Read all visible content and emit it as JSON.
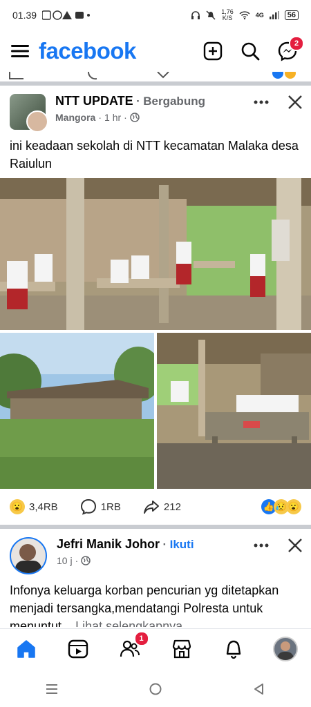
{
  "status_bar": {
    "time": "01.39",
    "speed_value": "1,76",
    "speed_unit": "K/S",
    "network": "4G",
    "battery": "56"
  },
  "header": {
    "logo": "facebook",
    "messenger_badge": "2"
  },
  "post1": {
    "group_name": "NTT UPDATE",
    "separator": "·",
    "join_label": "Bergabung",
    "author": "Mangora",
    "time": "1 hr",
    "text": "ini keadaan sekolah di NTT kecamatan Malaka desa Raiulun",
    "reaction_count": "3,4RB",
    "comment_count": "1RB",
    "share_count": "212"
  },
  "post2": {
    "author": "Jefri Manik Johor",
    "separator": "·",
    "follow_label": "Ikuti",
    "time": "10 j",
    "text": "Infonya keluarga korban pencurian yg ditetapkan menjadi tersangka,mendatangi Polresta untuk menuntut...",
    "see_more": "Lihat selengkapnya"
  },
  "bottom_nav": {
    "friends_badge": "1"
  },
  "colors": {
    "brand": "#1877f2",
    "badge": "#e41e3f",
    "secondary_text": "#65676b"
  }
}
